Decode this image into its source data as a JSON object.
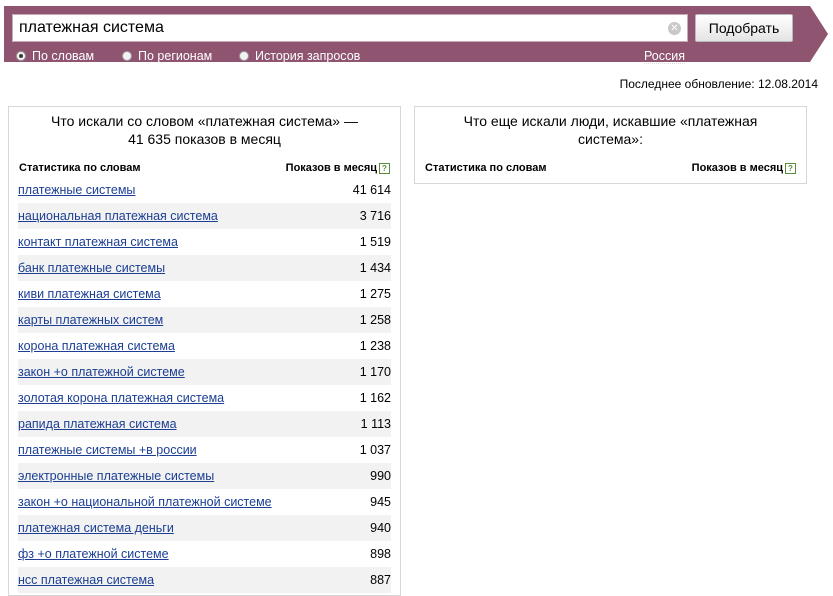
{
  "search": {
    "query": "платежная система",
    "submit_label": "Подобрать",
    "clear_icon": "close-circle-icon"
  },
  "modes": [
    {
      "label": "По словам",
      "selected": true
    },
    {
      "label": "По регионам",
      "selected": false
    },
    {
      "label": "История запросов",
      "selected": false
    }
  ],
  "region": "Россия",
  "last_update": "Последнее обновление: 12.08.2014",
  "left_panel": {
    "title": "Что искали со словом «платежная система» — 41 635 показов в месяц",
    "col_keywords": "Статистика по словам",
    "col_impressions": "Показов в месяц",
    "help_glyph": "?",
    "rows": [
      {
        "keyword": "платежные системы",
        "count": "41 614"
      },
      {
        "keyword": "национальная платежная система",
        "count": "3 716"
      },
      {
        "keyword": "контакт платежная система",
        "count": "1 519"
      },
      {
        "keyword": "банк платежные системы",
        "count": "1 434"
      },
      {
        "keyword": "киви платежная система",
        "count": "1 275"
      },
      {
        "keyword": "карты платежных систем",
        "count": "1 258"
      },
      {
        "keyword": "корона платежная система",
        "count": "1 238"
      },
      {
        "keyword": "закон +о платежной системе",
        "count": "1 170"
      },
      {
        "keyword": "золотая корона платежная система",
        "count": "1 162"
      },
      {
        "keyword": "рапида платежная система",
        "count": "1 113"
      },
      {
        "keyword": "платежные системы +в россии",
        "count": "1 037"
      },
      {
        "keyword": "электронные платежные системы",
        "count": "990"
      },
      {
        "keyword": "закон +о национальной платежной системе",
        "count": "945"
      },
      {
        "keyword": "платежная система деньги",
        "count": "940"
      },
      {
        "keyword": "фз +о платежной системе",
        "count": "898"
      },
      {
        "keyword": "нсс платежная система",
        "count": "887"
      }
    ]
  },
  "right_panel": {
    "title": "Что еще искали люди, искавшие «платежная система»:",
    "col_keywords": "Статистика по словам",
    "col_impressions": "Показов в месяц",
    "help_glyph": "?"
  },
  "colors": {
    "header_bg": "#8e5470",
    "link": "#1c3f94",
    "alt_row": "#f2f2f2"
  }
}
